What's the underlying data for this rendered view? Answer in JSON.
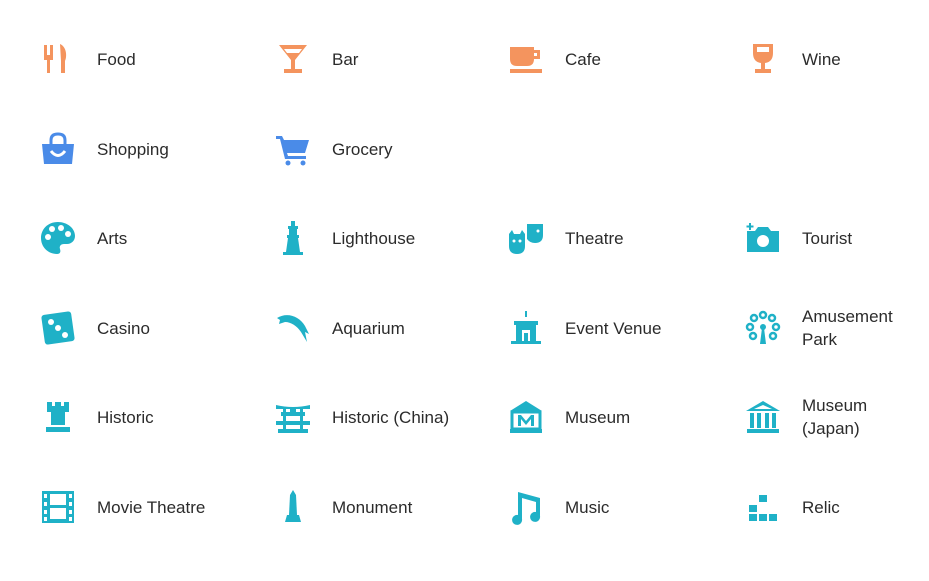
{
  "colors": {
    "food": "#F4945E",
    "shopping": "#4A8BE8",
    "culture": "#1FB1C7"
  },
  "items": [
    {
      "label": "Food",
      "icon": "fork-knife-icon",
      "group": "food"
    },
    {
      "label": "Bar",
      "icon": "cocktail-icon",
      "group": "food"
    },
    {
      "label": "Cafe",
      "icon": "coffee-cup-icon",
      "group": "food"
    },
    {
      "label": "Wine",
      "icon": "wine-glass-icon",
      "group": "food"
    },
    {
      "label": "Shopping",
      "icon": "shopping-bag-icon",
      "group": "shopping"
    },
    {
      "label": "Grocery",
      "icon": "shopping-cart-icon",
      "group": "shopping"
    },
    {
      "label": "Arts",
      "icon": "palette-icon",
      "group": "culture"
    },
    {
      "label": "Lighthouse",
      "icon": "lighthouse-icon",
      "group": "culture"
    },
    {
      "label": "Theatre",
      "icon": "theatre-masks-icon",
      "group": "culture"
    },
    {
      "label": "Tourist",
      "icon": "camera-icon",
      "group": "culture"
    },
    {
      "label": "Casino",
      "icon": "dice-icon",
      "group": "culture"
    },
    {
      "label": "Aquarium",
      "icon": "dolphin-icon",
      "group": "culture"
    },
    {
      "label": "Event Venue",
      "icon": "event-venue-icon",
      "group": "culture"
    },
    {
      "label": "Amusement Park",
      "icon": "ferris-wheel-icon",
      "group": "culture"
    },
    {
      "label": "Historic",
      "icon": "castle-tower-icon",
      "group": "culture"
    },
    {
      "label": "Historic (China)",
      "icon": "chinese-gate-icon",
      "group": "culture"
    },
    {
      "label": "Museum",
      "icon": "museum-m-icon",
      "group": "culture"
    },
    {
      "label": "Museum (Japan)",
      "icon": "museum-columns-icon",
      "group": "culture"
    },
    {
      "label": "Movie Theatre",
      "icon": "film-strip-icon",
      "group": "culture"
    },
    {
      "label": "Monument",
      "icon": "obelisk-icon",
      "group": "culture"
    },
    {
      "label": "Music",
      "icon": "music-note-icon",
      "group": "culture"
    },
    {
      "label": "Relic",
      "icon": "relic-blocks-icon",
      "group": "culture"
    }
  ]
}
